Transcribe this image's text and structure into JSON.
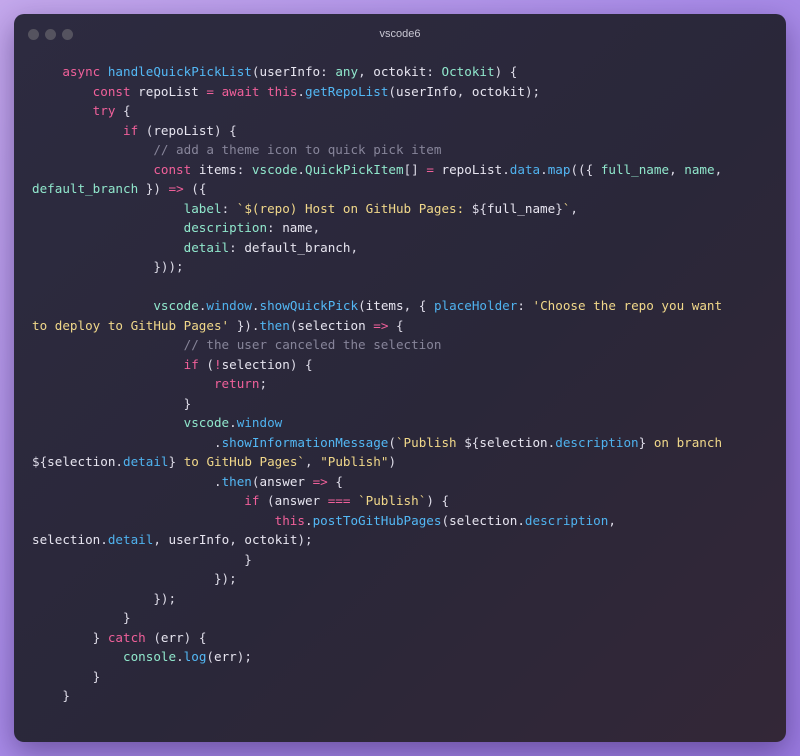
{
  "window": {
    "title": "vscode6"
  },
  "colors": {
    "keyword": "#f0609a",
    "function": "#53b8f5",
    "type": "#90e7cc",
    "property": "#4fb2ee",
    "string": "#f1d88a",
    "comment": "#87859a",
    "text": "#e7e5f0"
  },
  "code": {
    "lines": [
      [
        [
          "kw",
          "    async "
        ],
        [
          "fn",
          "handleQuickPickList"
        ],
        [
          "pl",
          "("
        ],
        [
          "var",
          "userInfo"
        ],
        [
          "pl",
          ": "
        ],
        [
          "type",
          "any"
        ],
        [
          "pl",
          ", "
        ],
        [
          "var",
          "octokit"
        ],
        [
          "pl",
          ": "
        ],
        [
          "type",
          "Octokit"
        ],
        [
          "pl",
          ") {"
        ]
      ],
      [
        [
          "kw",
          "        const "
        ],
        [
          "var",
          "repoList"
        ],
        [
          "op",
          " = "
        ],
        [
          "kw",
          "await "
        ],
        [
          "kw",
          "this"
        ],
        [
          "pl",
          "."
        ],
        [
          "fn",
          "getRepoList"
        ],
        [
          "pl",
          "("
        ],
        [
          "var",
          "userInfo"
        ],
        [
          "pl",
          ", "
        ],
        [
          "var",
          "octokit"
        ],
        [
          "pl",
          ");"
        ]
      ],
      [
        [
          "kw",
          "        try "
        ],
        [
          "pl",
          "{"
        ]
      ],
      [
        [
          "kw",
          "            if "
        ],
        [
          "pl",
          "("
        ],
        [
          "var",
          "repoList"
        ],
        [
          "pl",
          ") {"
        ]
      ],
      [
        [
          "cm",
          "                // add a theme icon to quick pick item"
        ]
      ],
      [
        [
          "kw",
          "                const "
        ],
        [
          "var",
          "items"
        ],
        [
          "pl",
          ": "
        ],
        [
          "type",
          "vscode"
        ],
        [
          "pl",
          "."
        ],
        [
          "type",
          "QuickPickItem"
        ],
        [
          "pl",
          "[] "
        ],
        [
          "op",
          "="
        ],
        [
          "pl",
          " "
        ],
        [
          "var",
          "repoList"
        ],
        [
          "pl",
          "."
        ],
        [
          "prop",
          "data"
        ],
        [
          "pl",
          "."
        ],
        [
          "fn",
          "map"
        ],
        [
          "pl",
          "(({ "
        ],
        [
          "type",
          "full_name"
        ],
        [
          "pl",
          ", "
        ],
        [
          "type",
          "name"
        ],
        [
          "pl",
          ","
        ]
      ],
      [
        [
          "type",
          "default_branch"
        ],
        [
          "pl",
          " }) "
        ],
        [
          "op",
          "=>"
        ],
        [
          "pl",
          " ({"
        ]
      ],
      [
        [
          "type",
          "                    label"
        ],
        [
          "pl",
          ": "
        ],
        [
          "str",
          "`$(repo) Host on GitHub Pages: "
        ],
        [
          "pl",
          "${"
        ],
        [
          "var",
          "full_name"
        ],
        [
          "pl",
          "}"
        ],
        [
          "str",
          "`"
        ],
        [
          "pl",
          ","
        ]
      ],
      [
        [
          "type",
          "                    description"
        ],
        [
          "pl",
          ": "
        ],
        [
          "var",
          "name"
        ],
        [
          "pl",
          ","
        ]
      ],
      [
        [
          "type",
          "                    detail"
        ],
        [
          "pl",
          ": "
        ],
        [
          "var",
          "default_branch"
        ],
        [
          "pl",
          ","
        ]
      ],
      [
        [
          "pl",
          "                }));"
        ]
      ],
      [
        [
          "pl",
          ""
        ]
      ],
      [
        [
          "type",
          "                vscode"
        ],
        [
          "pl",
          "."
        ],
        [
          "prop",
          "window"
        ],
        [
          "pl",
          "."
        ],
        [
          "fn",
          "showQuickPick"
        ],
        [
          "pl",
          "("
        ],
        [
          "var",
          "items"
        ],
        [
          "pl",
          ", { "
        ],
        [
          "prop",
          "placeHolder"
        ],
        [
          "pl",
          ": "
        ],
        [
          "str",
          "'Choose the repo you want"
        ]
      ],
      [
        [
          "str",
          "to deploy to GitHub Pages'"
        ],
        [
          "pl",
          " })."
        ],
        [
          "fn",
          "then"
        ],
        [
          "pl",
          "("
        ],
        [
          "var",
          "selection"
        ],
        [
          "op",
          " => "
        ],
        [
          "pl",
          "{"
        ]
      ],
      [
        [
          "cm",
          "                    // the user canceled the selection"
        ]
      ],
      [
        [
          "kw",
          "                    if "
        ],
        [
          "pl",
          "("
        ],
        [
          "op",
          "!"
        ],
        [
          "var",
          "selection"
        ],
        [
          "pl",
          ") {"
        ]
      ],
      [
        [
          "kw",
          "                        return"
        ],
        [
          "pl",
          ";"
        ]
      ],
      [
        [
          "pl",
          "                    }"
        ]
      ],
      [
        [
          "type",
          "                    vscode"
        ],
        [
          "pl",
          "."
        ],
        [
          "prop",
          "window"
        ]
      ],
      [
        [
          "pl",
          "                        ."
        ],
        [
          "fn",
          "showInformationMessage"
        ],
        [
          "pl",
          "("
        ],
        [
          "str",
          "`Publish "
        ],
        [
          "pl",
          "${"
        ],
        [
          "var",
          "selection"
        ],
        [
          "pl",
          "."
        ],
        [
          "prop",
          "description"
        ],
        [
          "pl",
          "}"
        ],
        [
          "str",
          " on branch"
        ]
      ],
      [
        [
          "pl",
          "${"
        ],
        [
          "var",
          "selection"
        ],
        [
          "pl",
          "."
        ],
        [
          "prop",
          "detail"
        ],
        [
          "pl",
          "}"
        ],
        [
          "str",
          " to GitHub Pages`"
        ],
        [
          "pl",
          ", "
        ],
        [
          "str",
          "\"Publish\""
        ],
        [
          "pl",
          ")"
        ]
      ],
      [
        [
          "pl",
          "                        ."
        ],
        [
          "fn",
          "then"
        ],
        [
          "pl",
          "("
        ],
        [
          "var",
          "answer"
        ],
        [
          "op",
          " => "
        ],
        [
          "pl",
          "{"
        ]
      ],
      [
        [
          "kw",
          "                            if "
        ],
        [
          "pl",
          "("
        ],
        [
          "var",
          "answer"
        ],
        [
          "op",
          " === "
        ],
        [
          "str",
          "`Publish`"
        ],
        [
          "pl",
          ") {"
        ]
      ],
      [
        [
          "kw",
          "                                this"
        ],
        [
          "pl",
          "."
        ],
        [
          "fn",
          "postToGitHubPages"
        ],
        [
          "pl",
          "("
        ],
        [
          "var",
          "selection"
        ],
        [
          "pl",
          "."
        ],
        [
          "prop",
          "description"
        ],
        [
          "pl",
          ","
        ]
      ],
      [
        [
          "var",
          "selection"
        ],
        [
          "pl",
          "."
        ],
        [
          "prop",
          "detail"
        ],
        [
          "pl",
          ", "
        ],
        [
          "var",
          "userInfo"
        ],
        [
          "pl",
          ", "
        ],
        [
          "var",
          "octokit"
        ],
        [
          "pl",
          ");"
        ]
      ],
      [
        [
          "pl",
          "                            }"
        ]
      ],
      [
        [
          "pl",
          "                        });"
        ]
      ],
      [
        [
          "pl",
          "                });"
        ]
      ],
      [
        [
          "pl",
          "            }"
        ]
      ],
      [
        [
          "pl",
          "        } "
        ],
        [
          "kw",
          "catch "
        ],
        [
          "pl",
          "("
        ],
        [
          "var",
          "err"
        ],
        [
          "pl",
          ") {"
        ]
      ],
      [
        [
          "type",
          "            console"
        ],
        [
          "pl",
          "."
        ],
        [
          "fn",
          "log"
        ],
        [
          "pl",
          "("
        ],
        [
          "var",
          "err"
        ],
        [
          "pl",
          ");"
        ]
      ],
      [
        [
          "pl",
          "        }"
        ]
      ],
      [
        [
          "pl",
          "    }"
        ]
      ]
    ]
  }
}
